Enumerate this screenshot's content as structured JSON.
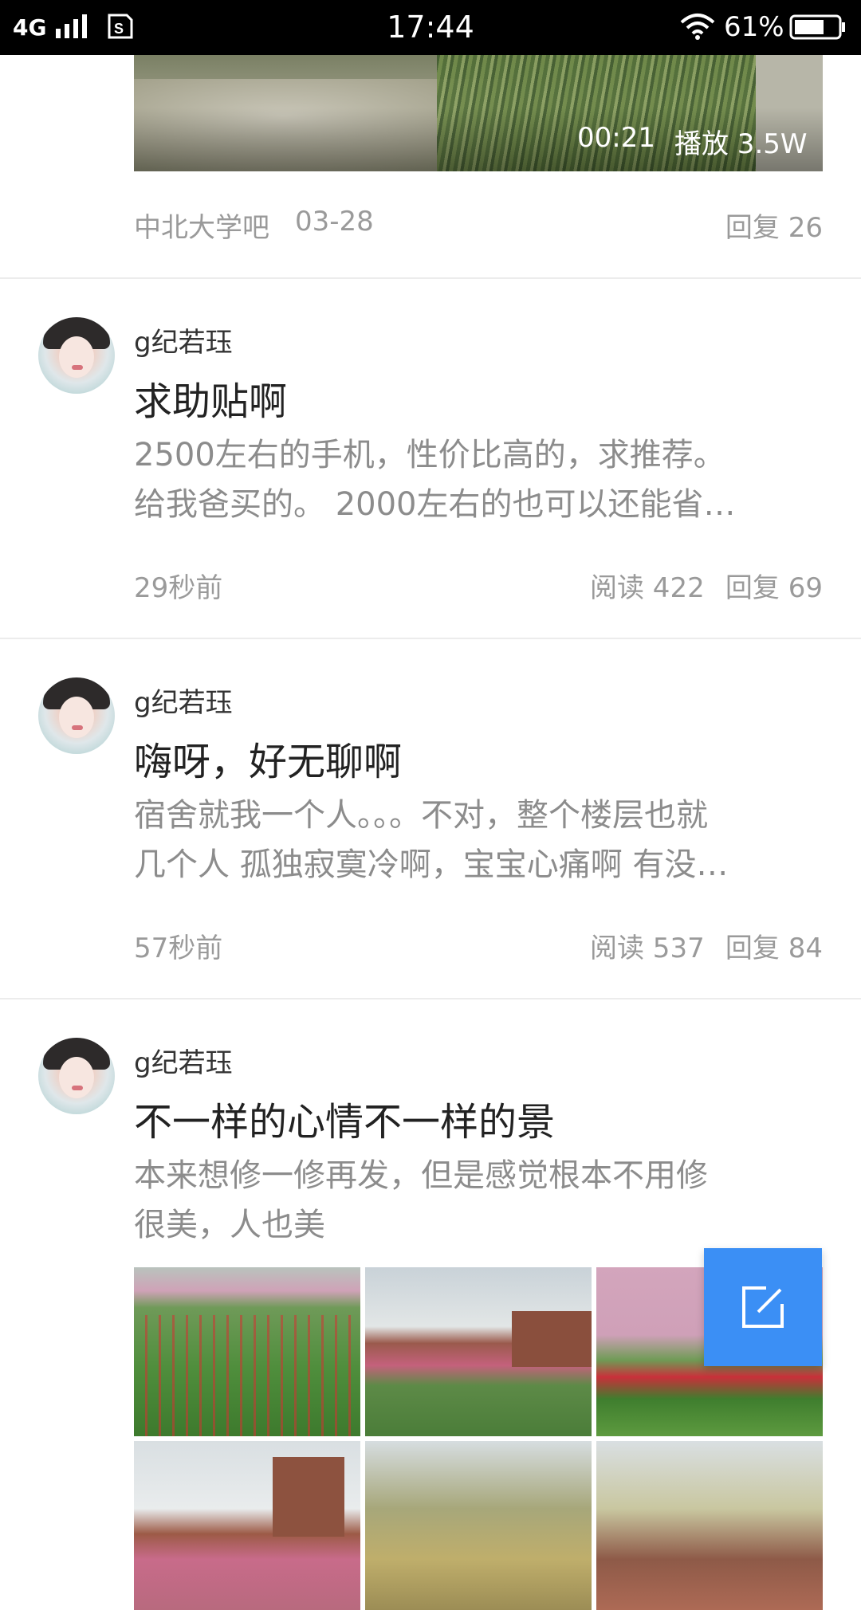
{
  "status_bar": {
    "network": "4G",
    "time": "17:44",
    "battery_percent": "61%"
  },
  "video_post": {
    "duration": "00:21",
    "plays": "播放 3.5W",
    "forum": "中北大学吧",
    "date": "03-28",
    "replies": "回复 26"
  },
  "posts": [
    {
      "author": "g纪若珏",
      "title": "求助贴啊",
      "excerpt_line1": "2500左右的手机，性价比高的，求推荐。",
      "excerpt_line2": "给我爸买的。 2000左右的也可以还能省…",
      "time": "29秒前",
      "reads": "阅读 422",
      "replies": "回复 69"
    },
    {
      "author": "g纪若珏",
      "title": "嗨呀，好无聊啊",
      "excerpt_line1": "宿舍就我一个人。。。不对，整个楼层也就",
      "excerpt_line2": "几个人 孤独寂寞冷啊，宝宝心痛啊 有没…",
      "time": "57秒前",
      "reads": "阅读 537",
      "replies": "回复 84"
    },
    {
      "author": "g纪若珏",
      "title": "不一样的心情不一样的景",
      "excerpt_line1": "本来想修一修再发，但是感觉根本不用修",
      "excerpt_line2": "很美，人也美"
    }
  ],
  "fab": {
    "icon": "compose-icon",
    "color": "#3b8ff5"
  }
}
